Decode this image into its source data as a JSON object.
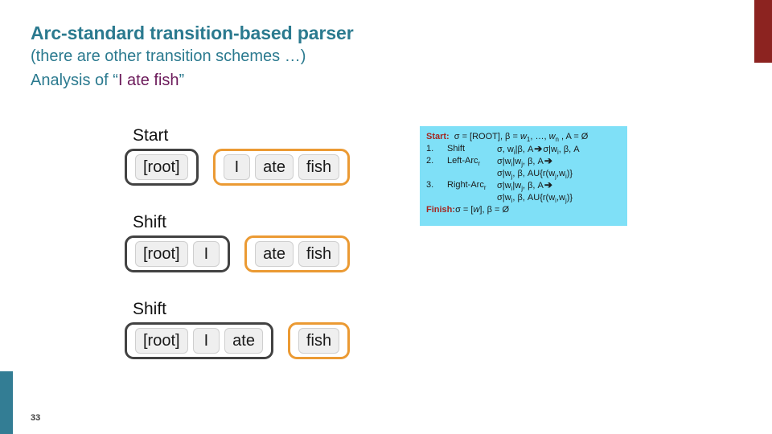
{
  "slide": {
    "title": "Arc-standard transition-based parser",
    "subtitle": "(there are other transition schemes …)",
    "analysis_prefix": "Analysis of “",
    "analysis_phrase": "I ate fish",
    "analysis_suffix": "”",
    "page_number": "33"
  },
  "colors": {
    "title_teal": "#2b7a8f",
    "phrase_purple": "#6b1a5a",
    "stack_border": "#424242",
    "buffer_border": "#eb9a33",
    "panel_background": "#7fe0f7",
    "panel_keyword": "#a32823",
    "accent_red_bar": "#8c2320",
    "accent_teal_bar": "#337d94"
  },
  "rows": [
    {
      "label": "Start",
      "stack": [
        "[root]"
      ],
      "buffer": [
        "I",
        "ate",
        "fish"
      ]
    },
    {
      "label": "Shift",
      "stack": [
        "[root]",
        "I"
      ],
      "buffer": [
        "ate",
        "fish"
      ]
    },
    {
      "label": "Shift",
      "stack": [
        "[root]",
        "I",
        "ate"
      ],
      "buffer": [
        "fish"
      ]
    }
  ],
  "algorithm": {
    "start_label": "Start:",
    "start_body_pre": "σ = [ROOT], β = ",
    "start_w1": "w",
    "start_w1_sub": "1",
    "start_mid": ", …, ",
    "start_wn": "w",
    "start_wn_sub": "n",
    "start_body_post": " , A = Ø",
    "steps": [
      {
        "num": "1.",
        "op": "Shift",
        "op_sub": "",
        "lhs": "σ, w",
        "lhs_sub": "i",
        "lhs_post": "|β, A",
        "arrow": "➔",
        "rhs": "σ|w",
        "rhs_sub": "i",
        "rhs_post": ", β, A",
        "cont": ""
      },
      {
        "num": "2.",
        "op": "Left-Arc",
        "op_sub": "r",
        "lhs": "σ|w",
        "lhs_sub": "i",
        "lhs_mid": "|w",
        "lhs_mid_sub": "j",
        "lhs_post": ", β, A",
        "arrow": "➔",
        "cont_pre": "σ|w",
        "cont_sub": "j",
        "cont_mid": ", β, AU{r(w",
        "cont_sub2": "j",
        "cont_mid2": ",w",
        "cont_sub3": "i",
        "cont_post": ")}"
      },
      {
        "num": "3.",
        "op": "Right-Arc",
        "op_sub": "r",
        "lhs": "σ|w",
        "lhs_sub": "i",
        "lhs_mid": "|w",
        "lhs_mid_sub": "j",
        "lhs_post": ", β, A",
        "arrow": "➔",
        "cont_pre": "σ|w",
        "cont_sub": "i",
        "cont_mid": ", β, AU{r(w",
        "cont_sub2": "i",
        "cont_mid2": ",w",
        "cont_sub3": "j",
        "cont_post": ")}"
      }
    ],
    "finish_label": "Finish:",
    "finish_body_pre": " σ = [",
    "finish_w": "w",
    "finish_body_post": "], β = Ø"
  }
}
